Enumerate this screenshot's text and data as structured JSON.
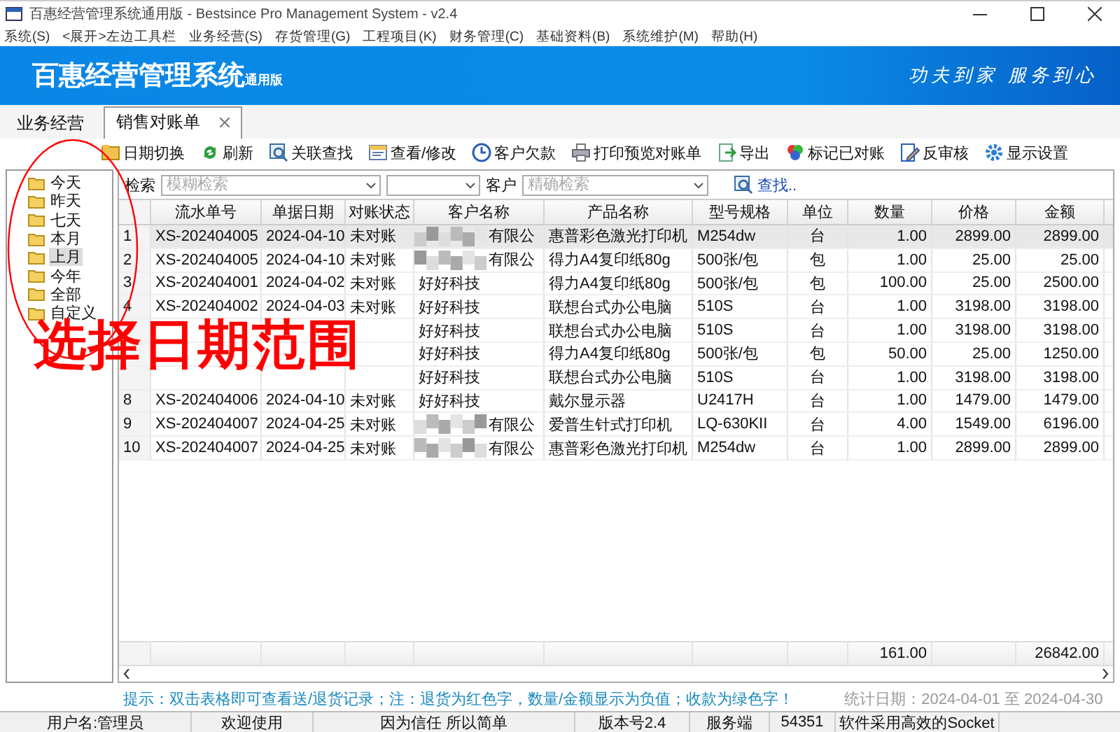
{
  "window": {
    "title": "百惠经营管理系统通用版 - Bestsince Pro Management System - v2.4"
  },
  "menu": [
    "系统(S)",
    "<展开>左边工具栏",
    "业务经营(S)",
    "存货管理(G)",
    "工程项目(K)",
    "财务管理(C)",
    "基础资料(B)",
    "系统维护(M)",
    "帮助(H)"
  ],
  "banner": {
    "title": "百惠经营管理系统",
    "edition": "通用版",
    "slogan": "功夫到家 服务到心"
  },
  "tabs": [
    {
      "label": "业务经营",
      "selected": false
    },
    {
      "label": "销售对账单",
      "selected": true
    }
  ],
  "toolbar": [
    "日期切换",
    "刷新",
    "关联查找",
    "查看/修改",
    "客户欠款",
    "打印预览对账单",
    "导出",
    "标记已对账",
    "反审核",
    "显示设置"
  ],
  "date_tree": [
    {
      "label": "今天",
      "selected": false
    },
    {
      "label": "昨天",
      "selected": false
    },
    {
      "label": "七天",
      "selected": false
    },
    {
      "label": "本月",
      "selected": false
    },
    {
      "label": "上月",
      "selected": true
    },
    {
      "label": "今年",
      "selected": false
    },
    {
      "label": "全部",
      "selected": false
    },
    {
      "label": "自定义",
      "selected": false
    }
  ],
  "search": {
    "label": "检索",
    "fuzzy_placeholder": "模糊检索",
    "customer_label": "客户",
    "exact_placeholder": "精确检索",
    "find": "查找.."
  },
  "table": {
    "columns": [
      "流水单号",
      "单据日期",
      "对账状态",
      "客户名称",
      "产品名称",
      "型号规格",
      "单位",
      "数量",
      "价格",
      "金额"
    ],
    "rows": [
      {
        "no": "1",
        "cells": [
          "XS-202404005",
          "2024-04-10",
          "未对账",
          "有限公",
          "惠普彩色激光打印机",
          "M254dw",
          "台",
          "1.00",
          "2899.00",
          "2899.00"
        ],
        "redacted": true,
        "selected": true
      },
      {
        "no": "2",
        "cells": [
          "XS-202404005",
          "2024-04-10",
          "未对账",
          "有限公",
          "得力A4复印纸80g",
          "500张/包",
          "包",
          "1.00",
          "25.00",
          "25.00"
        ],
        "redacted": true,
        "selected": false
      },
      {
        "no": "3",
        "cells": [
          "XS-202404001",
          "2024-04-02",
          "未对账",
          "好好科技",
          "得力A4复印纸80g",
          "500张/包",
          "包",
          "100.00",
          "25.00",
          "2500.00"
        ],
        "redacted": false,
        "selected": false
      },
      {
        "no": "4",
        "cells": [
          "XS-202404002",
          "2024-04-03",
          "未对账",
          "好好科技",
          "联想台式办公电脑",
          "510S",
          "台",
          "1.00",
          "3198.00",
          "3198.00"
        ],
        "redacted": false,
        "selected": false
      },
      {
        "no": null,
        "cells": [
          null,
          null,
          null,
          "好好科技",
          "联想台式办公电脑",
          "510S",
          "台",
          "1.00",
          "3198.00",
          "3198.00"
        ],
        "redacted": false,
        "selected": false
      },
      {
        "no": null,
        "cells": [
          null,
          null,
          null,
          "好好科技",
          "得力A4复印纸80g",
          "500张/包",
          "包",
          "50.00",
          "25.00",
          "1250.00"
        ],
        "redacted": false,
        "selected": false
      },
      {
        "no": null,
        "cells": [
          null,
          null,
          null,
          "好好科技",
          "联想台式办公电脑",
          "510S",
          "台",
          "1.00",
          "3198.00",
          "3198.00"
        ],
        "redacted": false,
        "selected": false
      },
      {
        "no": "8",
        "cells": [
          "XS-202404006",
          "2024-04-10",
          "未对账",
          "好好科技",
          "戴尔显示器",
          "U2417H",
          "台",
          "1.00",
          "1479.00",
          "1479.00"
        ],
        "redacted": false,
        "selected": false
      },
      {
        "no": "9",
        "cells": [
          "XS-202404007",
          "2024-04-25",
          "未对账",
          "有限公",
          "爱普生针式打印机",
          "LQ-630KII",
          "台",
          "4.00",
          "1549.00",
          "6196.00"
        ],
        "redacted": true,
        "selected": false
      },
      {
        "no": "10",
        "cells": [
          "XS-202404007",
          "2024-04-25",
          "未对账",
          "有限公",
          "惠普彩色激光打印机",
          "M254dw",
          "台",
          "1.00",
          "2899.00",
          "2899.00"
        ],
        "redacted": true,
        "selected": false
      }
    ],
    "totals": {
      "quantity": "161.00",
      "amount": "26842.00"
    }
  },
  "hint": "提示：双击表格即可查看送/退货记录；注：退货为红色字，数量/金额显示为负值；收款为绿色字！",
  "stats": "统计日期：2024-04-01 至 2024-04-30",
  "status_bar": [
    "用户名:管理员",
    "欢迎使用",
    "因为信任 所以简单",
    "版本号2.4",
    "服务端",
    "54351",
    "软件采用高效的Socket"
  ],
  "annotation": {
    "text": "选择日期范围",
    "color": "#ff0000"
  }
}
